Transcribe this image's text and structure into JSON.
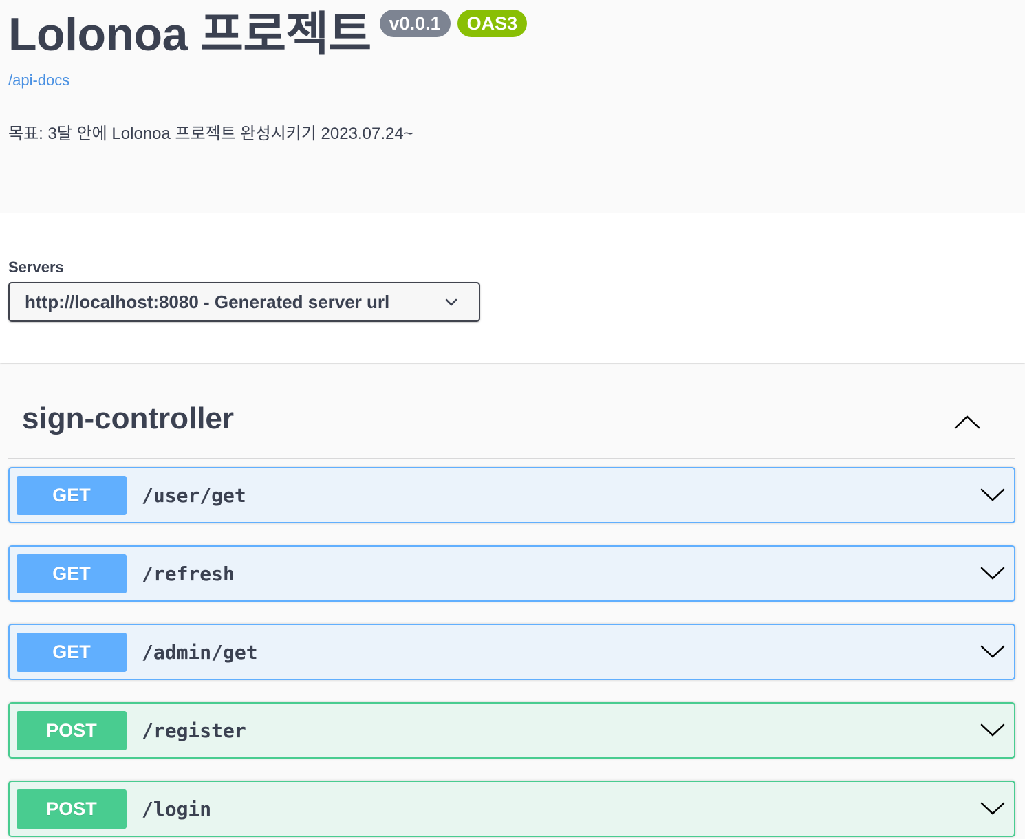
{
  "info": {
    "title": "Lolonoa 프로젝트",
    "version": "v0.0.1",
    "oas": "OAS3",
    "link": "/api-docs",
    "description": "목표: 3달 안에 Lolonoa 프로젝트 완성시키기 2023.07.24~"
  },
  "servers": {
    "label": "Servers",
    "selected": "http://localhost:8080 - Generated server url"
  },
  "tag": {
    "name": "sign-controller",
    "operations": [
      {
        "method": "GET",
        "path": "/user/get"
      },
      {
        "method": "GET",
        "path": "/refresh"
      },
      {
        "method": "GET",
        "path": "/admin/get"
      },
      {
        "method": "POST",
        "path": "/register"
      },
      {
        "method": "POST",
        "path": "/login"
      }
    ]
  },
  "colors": {
    "get": "#61affe",
    "post": "#49cc90",
    "link": "#4990e2",
    "text": "#3b4151"
  }
}
